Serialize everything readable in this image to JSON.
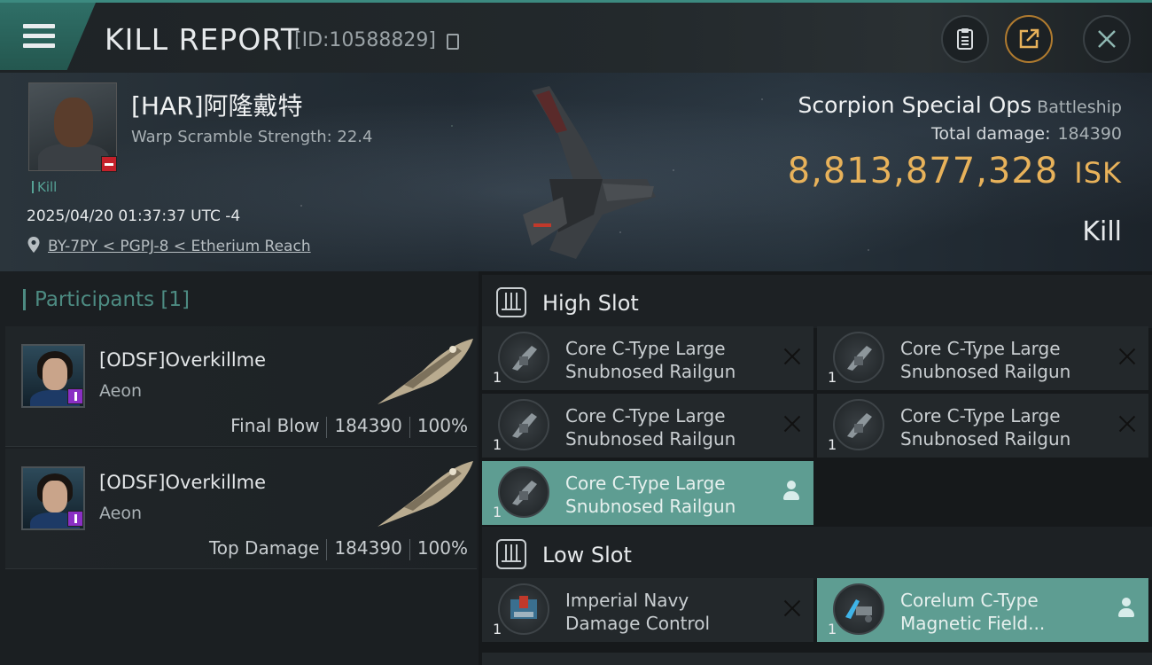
{
  "header": {
    "title": "KILL REPORT",
    "report_id": "[ID:10588829]"
  },
  "victim": {
    "name": "[HAR]阿隆戴特",
    "warp_scramble": "Warp Scramble Strength: 22.4",
    "kill_tag": "Kill",
    "datetime": "2025/04/20 01:37:37 UTC -4",
    "location": "BY-7PY < PGPJ-8 < Etherium Reach"
  },
  "ship": {
    "name": "Scorpion Special Ops",
    "class": "Battleship",
    "total_damage_label": "Total damage:",
    "total_damage_value": "184390",
    "isk_value": "8,813,877,328",
    "isk_unit": "ISK",
    "result": "Kill"
  },
  "participants": {
    "header": "Participants [1]",
    "items": [
      {
        "name": "[ODSF]Overkillme",
        "ship": "Aeon",
        "role": "Final Blow",
        "damage": "184390",
        "percent": "100%"
      },
      {
        "name": "[ODSF]Overkillme",
        "ship": "Aeon",
        "role": "Top Damage",
        "damage": "184390",
        "percent": "100%"
      }
    ]
  },
  "slots": {
    "high": {
      "title": "High Slot",
      "items": [
        {
          "qty": "1",
          "line1": "Core C-Type Large",
          "line2": "Snubnosed Railgun",
          "status": "destroyed"
        },
        {
          "qty": "1",
          "line1": "Core C-Type Large",
          "line2": "Snubnosed Railgun",
          "status": "destroyed"
        },
        {
          "qty": "1",
          "line1": "Core C-Type Large",
          "line2": "Snubnosed Railgun",
          "status": "destroyed"
        },
        {
          "qty": "1",
          "line1": "Core C-Type Large",
          "line2": "Snubnosed Railgun",
          "status": "destroyed"
        },
        {
          "qty": "1",
          "line1": "Core C-Type Large",
          "line2": "Snubnosed Railgun",
          "status": "dropped"
        }
      ]
    },
    "low": {
      "title": "Low Slot",
      "items": [
        {
          "qty": "1",
          "line1": "Imperial Navy",
          "line2": "Damage Control",
          "status": "destroyed"
        },
        {
          "qty": "1",
          "line1": "Corelum C-Type",
          "line2": "Magnetic Field...",
          "status": "dropped"
        }
      ]
    }
  },
  "colors": {
    "accent": "#3c8a80",
    "isk": "#e8b25a",
    "dropped_bg": "#5e9d92"
  },
  "icons": [
    "menu-icon",
    "copy-icon",
    "clipboard-icon",
    "share-icon",
    "close-icon",
    "location-pin-icon",
    "slot-icon",
    "person-icon",
    "x-icon"
  ]
}
